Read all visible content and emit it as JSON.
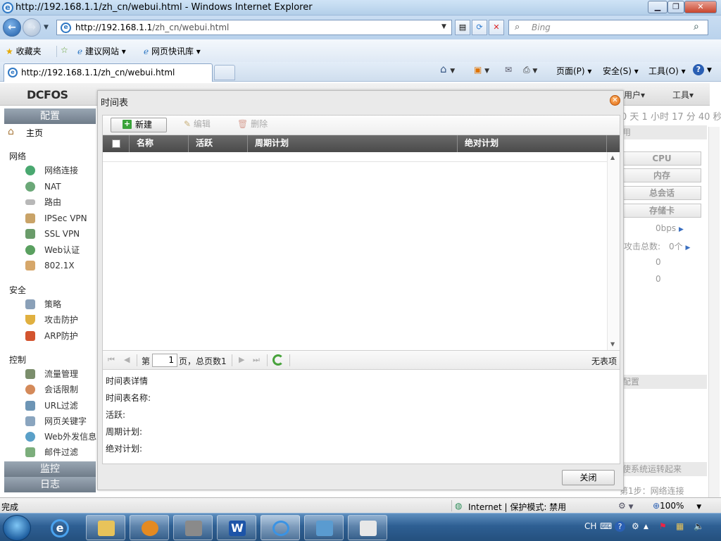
{
  "window": {
    "title": "http://192.168.1.1/zh_cn/webui.html - Windows Internet Explorer",
    "url_host": "http://192.168.1.1",
    "url_path": "/zh_cn/webui.html",
    "search_placeholder": "Bing"
  },
  "favorites": {
    "favorites_label": "收藏夹",
    "items": [
      "建议网站 ▾",
      "网页快讯库 ▾"
    ]
  },
  "tab": {
    "label": "http://192.168.1.1/zh_cn/webui.html"
  },
  "commands": {
    "page": "页面(P) ▾",
    "safety": "安全(S) ▾",
    "tools": "工具(O) ▾"
  },
  "app": {
    "logo": "DCFOS",
    "header_right": [
      "用户▾",
      "工具▾"
    ],
    "uptime": "0 天 1 小时 17 分 40 秒"
  },
  "nav": {
    "config_header": "配置",
    "home": "主页",
    "sections": [
      {
        "title": "网络",
        "items": [
          "网络连接",
          "NAT",
          "路由",
          "IPSec VPN",
          "SSL VPN",
          "Web认证",
          "802.1X"
        ]
      },
      {
        "title": "安全",
        "items": [
          "策略",
          "攻击防护",
          "ARP防护"
        ]
      },
      {
        "title": "控制",
        "items": [
          "流量管理",
          "会话限制",
          "URL过滤",
          "网页关键字",
          "Web外发信息",
          "邮件过滤"
        ]
      }
    ],
    "monitor_header": "监控",
    "log_header": "日志"
  },
  "dashboard": {
    "panel_head_1": "用",
    "buttons": [
      "CPU",
      "内存",
      "总会话",
      "存储卡"
    ],
    "rate_label": "：",
    "rate_value": "0bps",
    "attack_label": "攻击总数:",
    "attack_value": "0个",
    "zero1": "0",
    "zero2": "0",
    "panel_head_2": "配置",
    "panel_head_3": "使系统运转起来",
    "step_text": "第1步：网络连接"
  },
  "modal": {
    "title": "时间表",
    "toolbar": {
      "new": "新建",
      "edit": "编辑",
      "delete": "删除"
    },
    "columns": [
      "名称",
      "活跃",
      "周期计划",
      "绝对计划"
    ],
    "pager": {
      "page_prefix": "第",
      "page_value": "1",
      "page_suffix": "页，总页数1",
      "empty": "无表项"
    },
    "details": {
      "heading": "时间表详情",
      "name_label": "时间表名称:",
      "active_label": "活跃:",
      "periodic_label": "周期计划:",
      "absolute_label": "绝对计划:"
    },
    "close_button": "关闭"
  },
  "status": {
    "done": "完成",
    "zone": "Internet | 保护模式: 禁用",
    "zoom": "100%"
  },
  "taskbar": {
    "lang": "CH"
  }
}
